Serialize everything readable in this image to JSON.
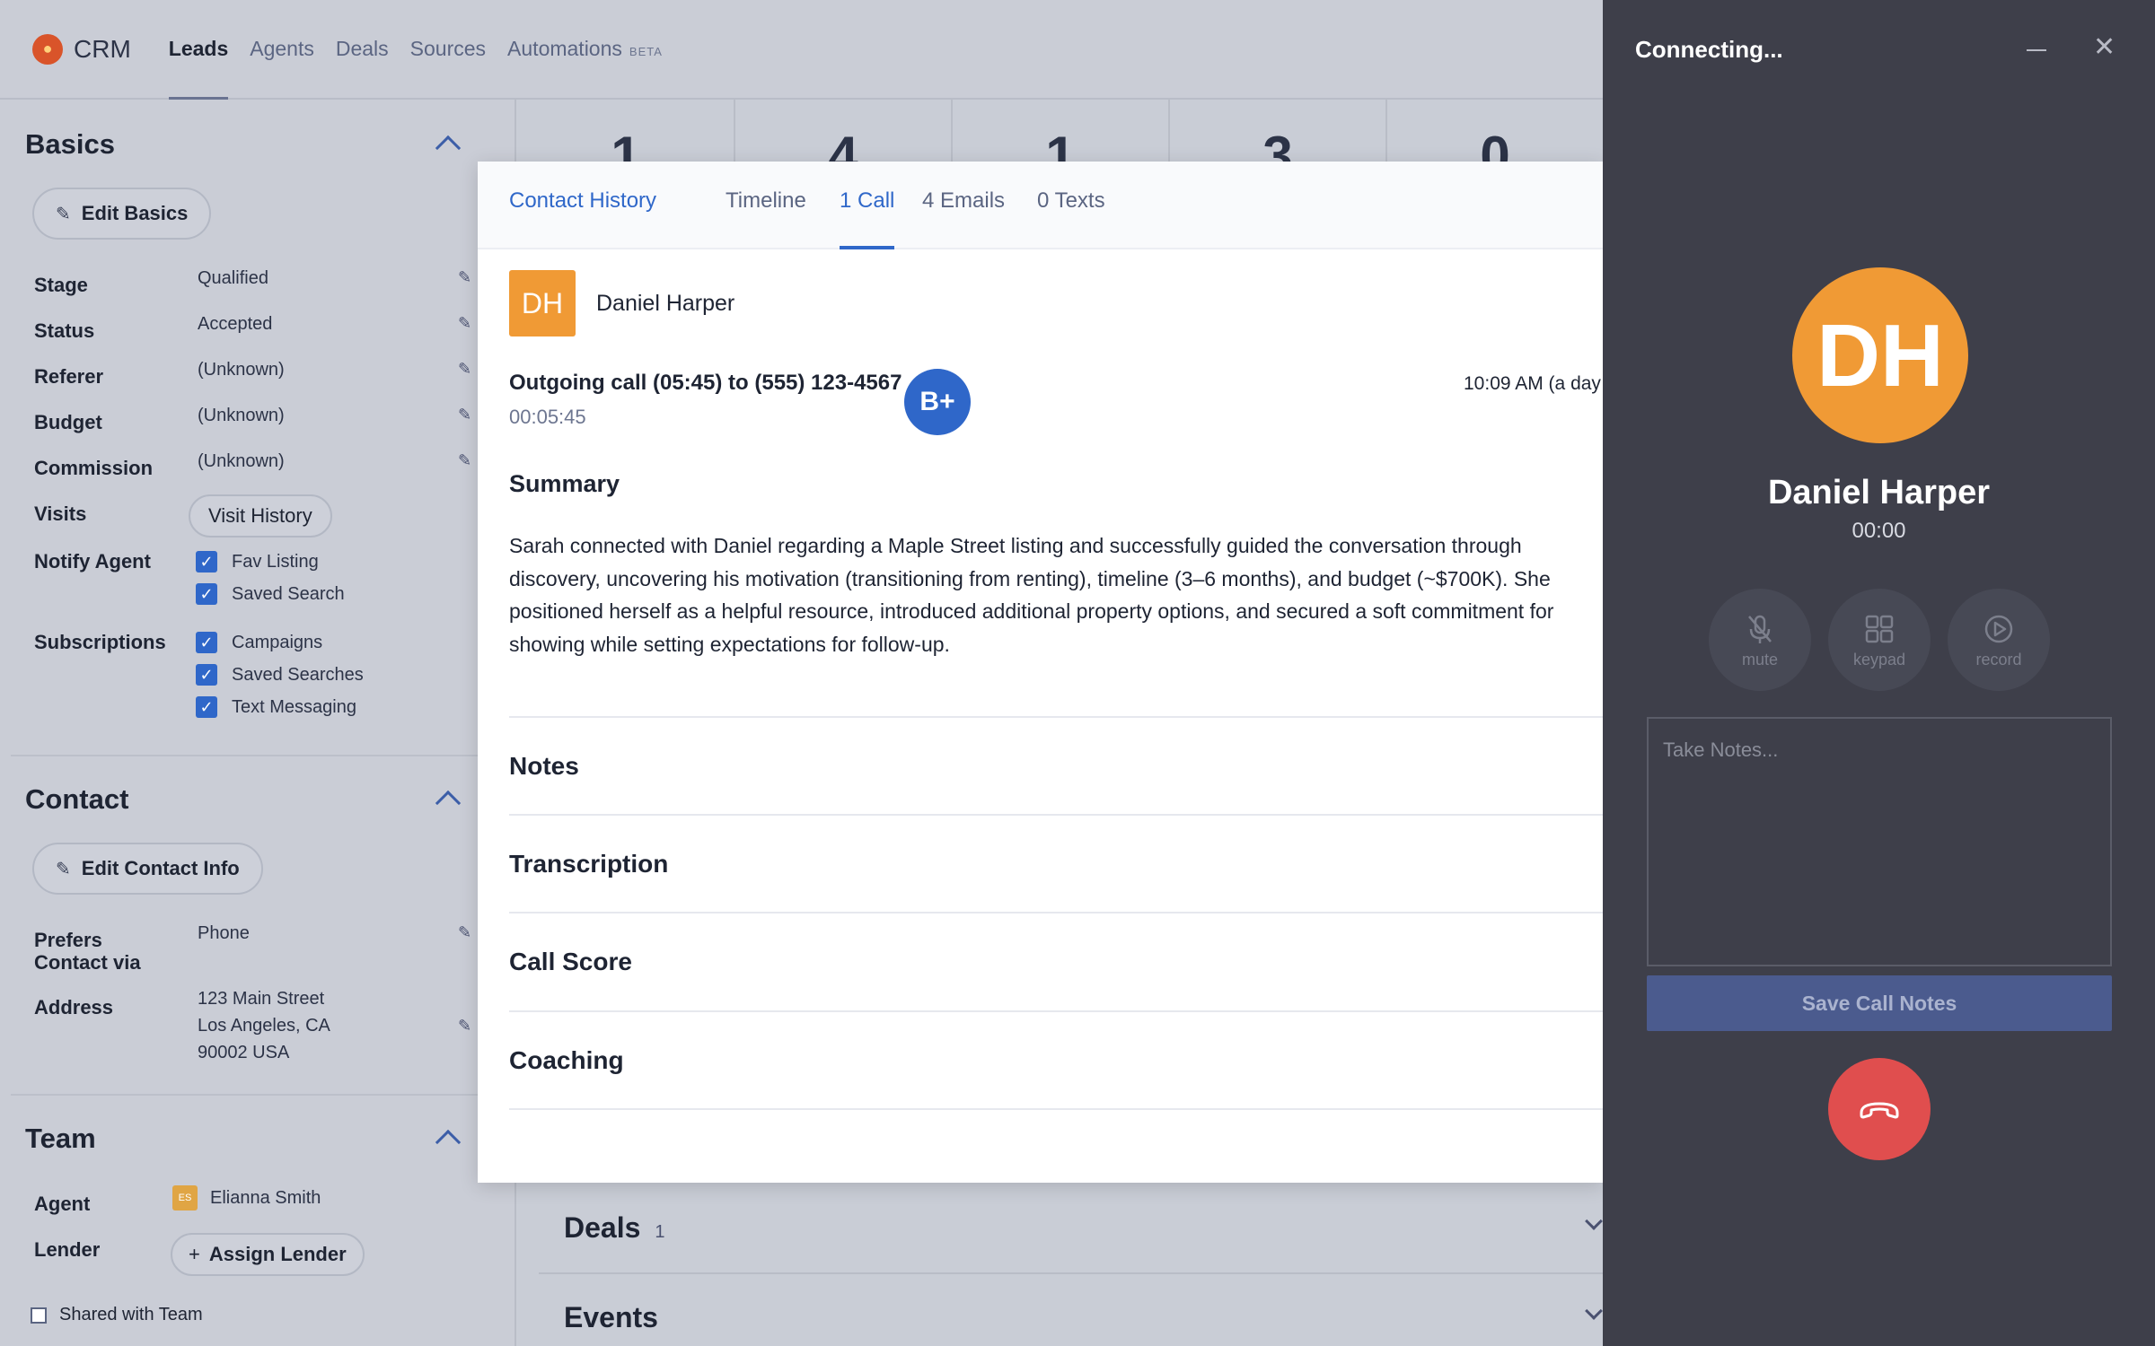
{
  "nav": {
    "brand": "CRM",
    "items": [
      {
        "label": "Leads"
      },
      {
        "label": "Agents"
      },
      {
        "label": "Deals"
      },
      {
        "label": "Sources"
      },
      {
        "label": "Automations"
      }
    ],
    "beta": "BETA"
  },
  "basics": {
    "title": "Basics",
    "edit_label": "Edit Basics",
    "fields": {
      "stage": {
        "label": "Stage",
        "value": "Qualified"
      },
      "status": {
        "label": "Status",
        "value": "Accepted"
      },
      "referer": {
        "label": "Referer",
        "value": "(Unknown)"
      },
      "budget": {
        "label": "Budget",
        "value": "(Unknown)"
      },
      "commission": {
        "label": "Commission",
        "value": "(Unknown)"
      },
      "visits": {
        "label": "Visits",
        "button": "Visit History"
      },
      "notify": {
        "label": "Notify Agent",
        "options": [
          "Fav Listing",
          "Saved Search"
        ]
      },
      "subscriptions": {
        "label": "Subscriptions",
        "options": [
          "Campaigns",
          "Saved Searches",
          "Text Messaging"
        ]
      }
    }
  },
  "contact": {
    "title": "Contact",
    "edit_label": "Edit Contact Info",
    "prefers_label_1": "Prefers",
    "prefers_label_2": "Contact via",
    "prefers_value": "Phone",
    "address_label": "Address",
    "address_lines": [
      "123 Main Street",
      "Los Angeles, CA",
      "90002 USA"
    ]
  },
  "team": {
    "title": "Team",
    "agent_label": "Agent",
    "agent_initials": "ES",
    "agent_name": "Elianna Smith",
    "lender_label": "Lender",
    "lender_button": "Assign Lender",
    "shared_label": "Shared with Team"
  },
  "stats": [
    "1",
    "4",
    "1",
    "3",
    "0"
  ],
  "background_rows": {
    "deals": {
      "title": "Deals",
      "count": "1"
    },
    "events": {
      "title": "Events"
    }
  },
  "history": {
    "tabs": [
      "Contact History",
      "Timeline",
      "1 Call",
      "4 Emails",
      "0 Texts"
    ],
    "contact_initials": "DH",
    "contact_name": "Daniel Harper",
    "call_line": "Outgoing call (05:45) to (555) 123-4567",
    "call_duration": "00:05:45",
    "grade": "B+",
    "call_time": "10:09 AM (a day",
    "summary_title": "Summary",
    "summary_body": "Sarah connected with Daniel regarding a Maple Street listing and successfully guided the conversation through discovery, uncovering his motivation (transitioning from renting), timeline (3–6 months), and budget (~$700K). She positioned herself as a helpful resource, introduced additional property options, and secured a soft commitment for showing while setting expectations for follow-up.",
    "sections": [
      "Notes",
      "Transcription",
      "Call Score",
      "Coaching"
    ]
  },
  "call_panel": {
    "title": "Connecting...",
    "initials": "DH",
    "name": "Daniel Harper",
    "timer": "00:00",
    "controls": [
      "mute",
      "keypad",
      "record"
    ],
    "notes_placeholder": "Take Notes...",
    "save_label": "Save Call Notes"
  },
  "colors": {
    "accent": "#2f67c9",
    "avatar_orange": "#f09a35",
    "hangup_red": "#e04e4e",
    "panel_dark": "#3e3f4a"
  }
}
